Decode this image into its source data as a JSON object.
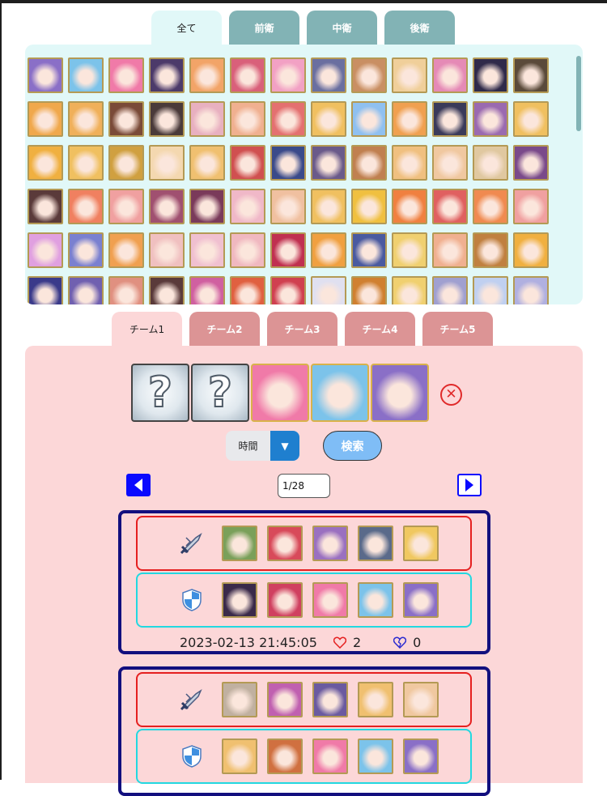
{
  "character_tabs": [
    {
      "label": "全て",
      "active": true
    },
    {
      "label": "前衛",
      "active": false
    },
    {
      "label": "中衛",
      "active": false
    },
    {
      "label": "後衛",
      "active": false
    }
  ],
  "character_grid": {
    "thumbnails": [
      "#8a6fc7",
      "#7cc3ea",
      "#f07aa8",
      "#4c3a6a",
      "#f2a468",
      "#d9607a",
      "#f2a1c4",
      "#6a6fa0",
      "#c98f63",
      "#f0cf9a",
      "#e58ab6",
      "#2f2a4a",
      "#5a4a3a",
      "#f0a84c",
      "#f0b05a",
      "#7a4a38",
      "#4a3a3a",
      "#e8b0c0",
      "#f0b090",
      "#e47070",
      "#f0c060",
      "#8fc0f0",
      "#f0a050",
      "#3a3a5a",
      "#9a6ab0",
      "#f0c060",
      "#f0b040",
      "#f0c060",
      "#d0a040",
      "#f4d8b0",
      "#f0c070",
      "#d05050",
      "#3a4a8a",
      "#6a5a8a",
      "#c08050",
      "#f0c080",
      "#f0c8a0",
      "#e0c8a0",
      "#7a4a8a",
      "#5a3a3a",
      "#f08060",
      "#f0a0a0",
      "#a05070",
      "#7a3a5a",
      "#f0b8c8",
      "#f0c0a0",
      "#f0c060",
      "#f0c040",
      "#f08040",
      "#e06060",
      "#f08a50",
      "#f0a0a0",
      "#e0a0e0",
      "#7a80d0",
      "#f0a050",
      "#f0c0c0",
      "#f0c0d0",
      "#f0b8c0",
      "#c03050",
      "#f0a040",
      "#4a5aa0",
      "#f0d070",
      "#f0b090",
      "#c08040",
      "#f0b040",
      "#3a3a8a",
      "#7060b0",
      "#e09080",
      "#5a3a3a",
      "#d060a0",
      "#e06040",
      "#d04050",
      "#e0e0f0",
      "#d08030",
      "#f0d070",
      "#a0a0d0",
      "#c0d0f0",
      "#b0b0e0",
      "#f0c070"
    ]
  },
  "team_tabs": [
    {
      "label": "チーム1",
      "active": true
    },
    {
      "label": "チーム2",
      "active": false
    },
    {
      "label": "チーム3",
      "active": false
    },
    {
      "label": "チーム4",
      "active": false
    },
    {
      "label": "チーム5",
      "active": false
    }
  ],
  "team_slots": [
    {
      "type": "unknown",
      "glyph": "?"
    },
    {
      "type": "unknown",
      "glyph": "?"
    },
    {
      "type": "filled",
      "color": "#f07aa8"
    },
    {
      "type": "filled",
      "color": "#7cc3ea"
    },
    {
      "type": "filled",
      "color": "#8a6fc7"
    }
  ],
  "clear_glyph": "✕",
  "sort_select": {
    "value": "時間",
    "arrow_glyph": "▼"
  },
  "search_label": "検索",
  "pagination": {
    "page": "1/28"
  },
  "results": [
    {
      "attack": [
        "#7aa05a",
        "#d84a5a",
        "#9a70c0",
        "#5a6a8a",
        "#f0c860"
      ],
      "defense": [
        "#3a2a4a",
        "#d04060",
        "#f07aa8",
        "#7cc3ea",
        "#8a6fc7"
      ],
      "timestamp": "2023-02-13 21:45:05",
      "likes": "2",
      "dislikes": "0"
    },
    {
      "attack": [
        "#c0b0a0",
        "#c060b0",
        "#6a5aa0",
        "#f0c070",
        "#f0c8a0"
      ],
      "defense": [
        "#f0c070",
        "#d07040",
        "#f07aa8",
        "#7cc3ea",
        "#8a6fc7"
      ]
    }
  ],
  "colors": {
    "char_panel_bg": "#e1f8f8",
    "team_panel_bg": "#fcd7d8",
    "attack_border": "#e52020",
    "defense_border": "#22d8e0",
    "card_border": "#120f7e",
    "accent_blue": "#0a0aff"
  }
}
